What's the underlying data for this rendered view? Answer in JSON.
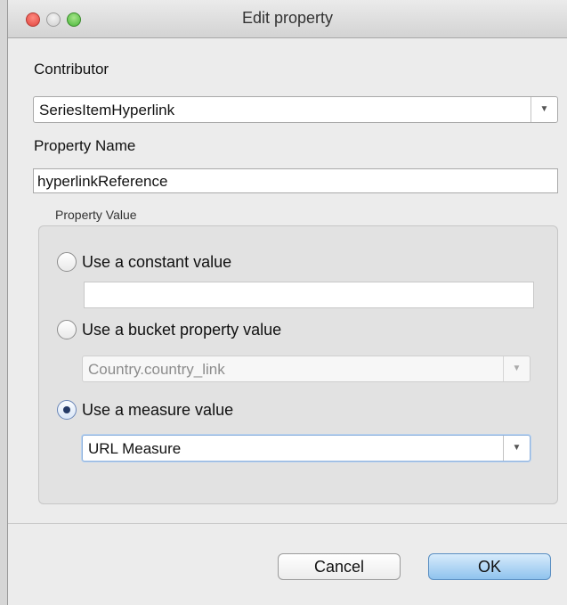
{
  "window": {
    "title": "Edit property"
  },
  "contributor": {
    "label": "Contributor",
    "value": "SeriesItemHyperlink"
  },
  "property_name": {
    "label": "Property Name",
    "value": "hyperlinkReference"
  },
  "property_value": {
    "group_label": "Property Value",
    "constant": {
      "label": "Use a constant value",
      "value": "",
      "selected": false
    },
    "bucket": {
      "label": "Use a bucket property value",
      "value": "Country.country_link",
      "selected": false
    },
    "measure": {
      "label": "Use a measure value",
      "value": "URL Measure",
      "selected": true
    }
  },
  "buttons": {
    "cancel": "Cancel",
    "ok": "OK"
  },
  "icons": {
    "dropdown": "chevron-down-icon",
    "close": "close-icon",
    "minimize": "minimize-icon",
    "zoom": "zoom-icon"
  },
  "colors": {
    "accent": "#8fc3ee",
    "close": "#e0443e",
    "zoom": "#48b638"
  }
}
